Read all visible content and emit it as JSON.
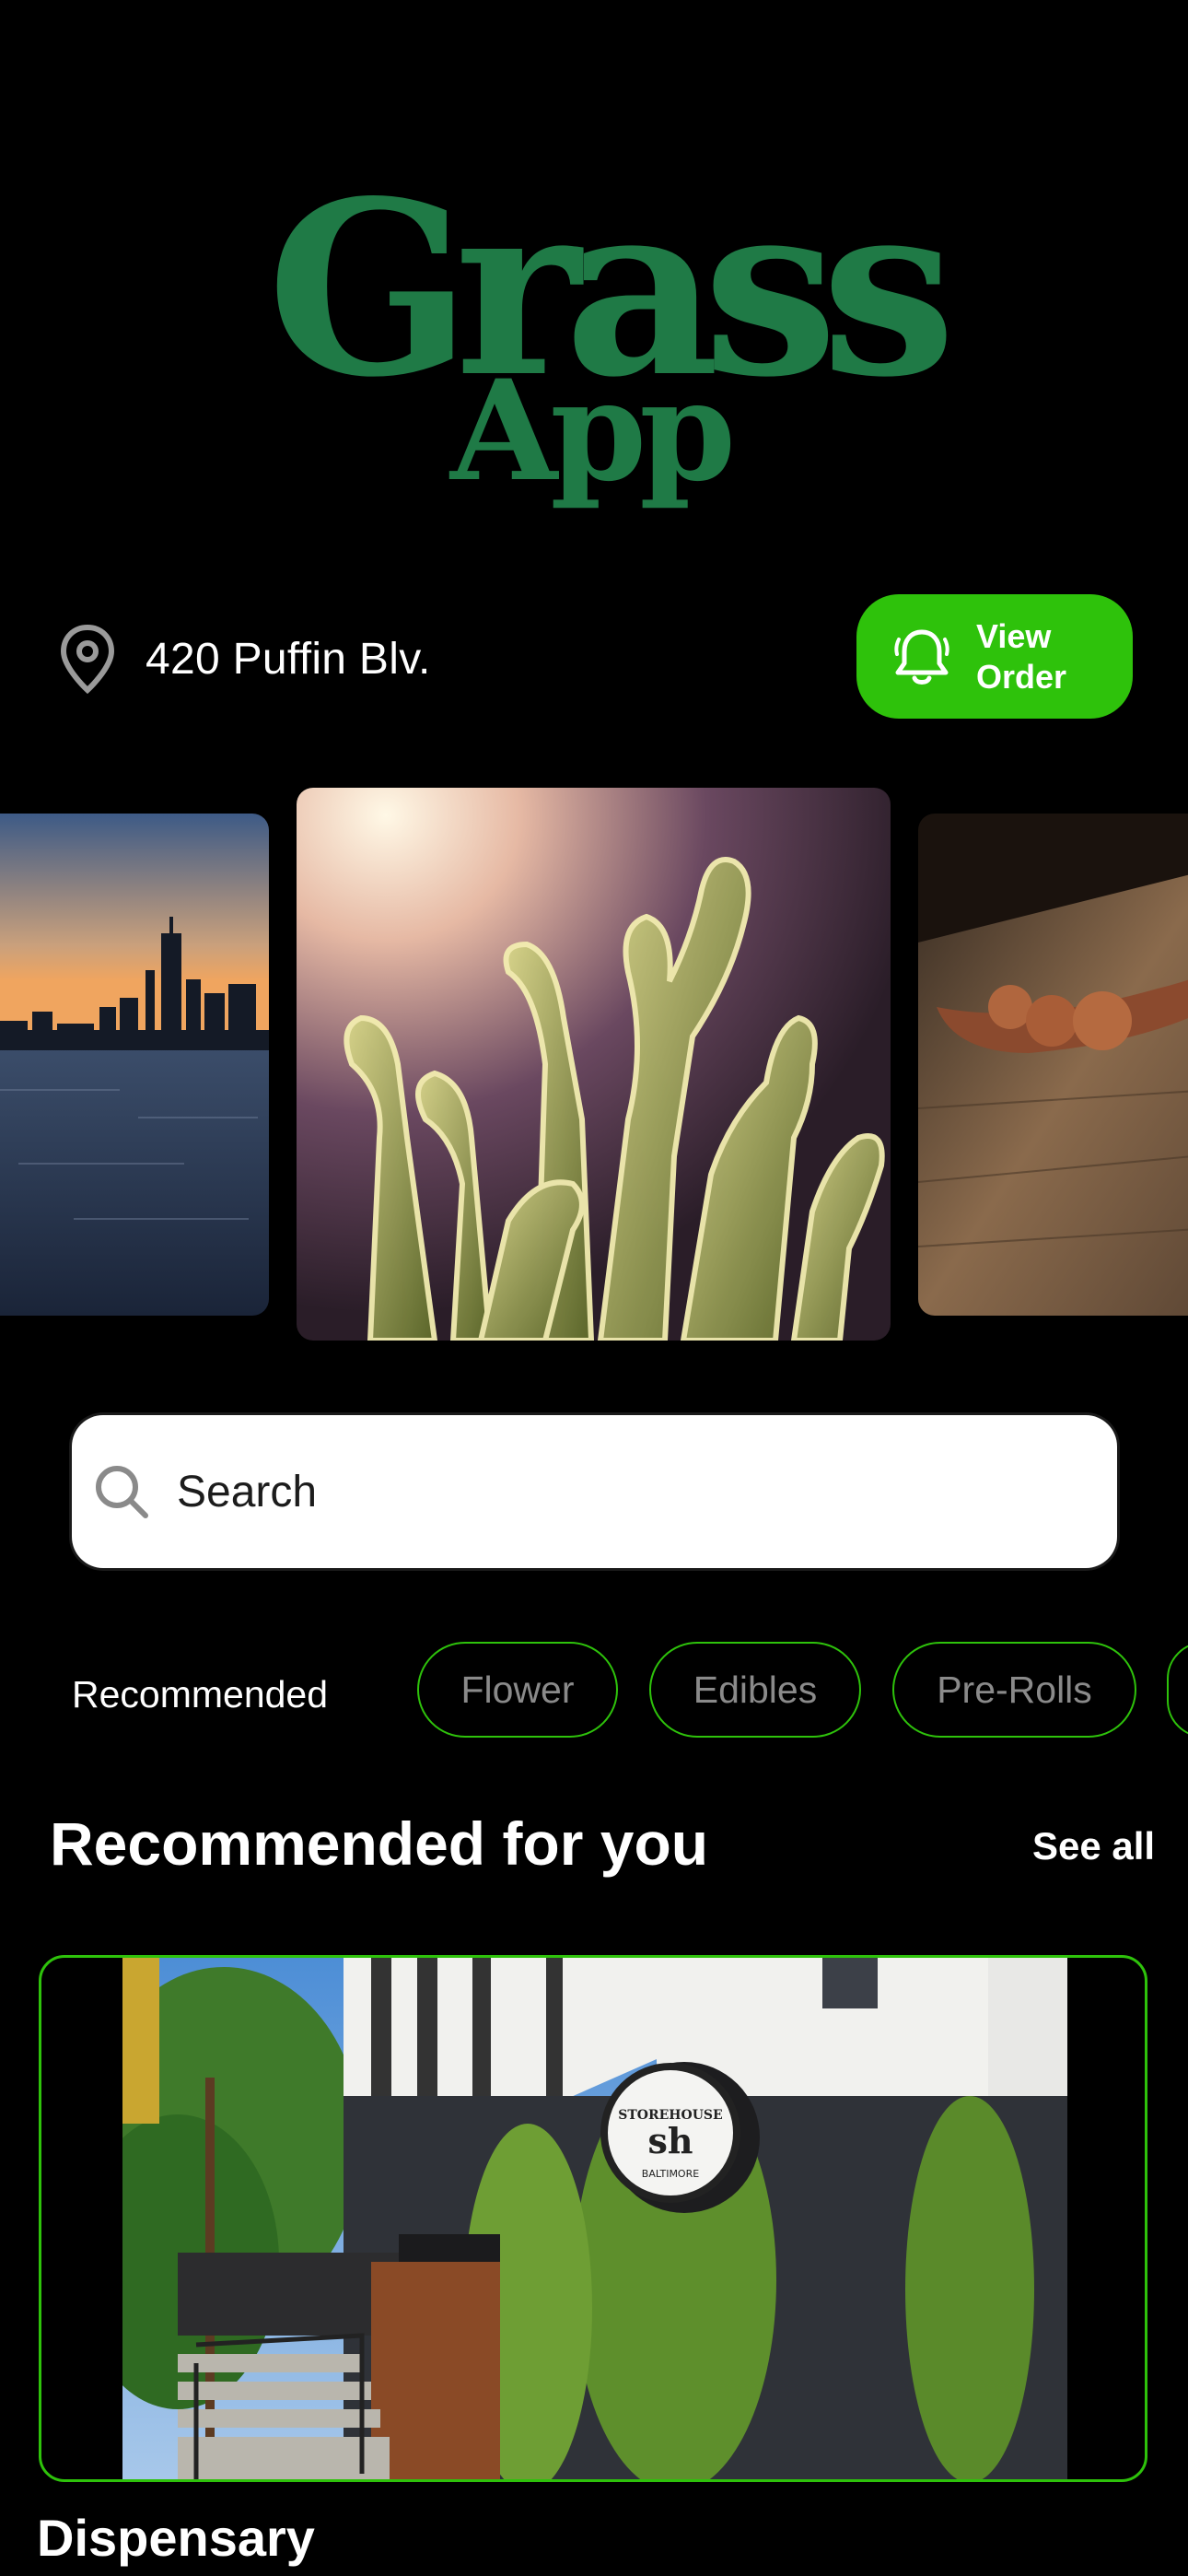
{
  "brand": {
    "logo_line1": "Grass",
    "logo_line2": "App",
    "color": "#1f7a46"
  },
  "header": {
    "address": "420 Puffin Blv.",
    "location_icon": "map-pin-icon",
    "view_order_line1": "View",
    "view_order_line2": "Order",
    "view_order_icon": "bell-icon",
    "accent": "#2ec20b"
  },
  "carousel": {
    "items": [
      {
        "subject": "city-skyline-icon"
      },
      {
        "subject": "cactus-icon"
      },
      {
        "subject": "seeds-icon"
      }
    ]
  },
  "search": {
    "placeholder": "Search",
    "icon": "search-icon"
  },
  "categories": {
    "active": "Recommended",
    "items": [
      "Flower",
      "Edibles",
      "Pre-Rolls"
    ]
  },
  "section": {
    "title": "Recommended for you",
    "see_all": "See all"
  },
  "recommended": {
    "items": [
      {
        "label": "Dispensary",
        "storefront_text": "STOREHOUSE",
        "storefront_sub": "BALTIMORE"
      }
    ]
  }
}
